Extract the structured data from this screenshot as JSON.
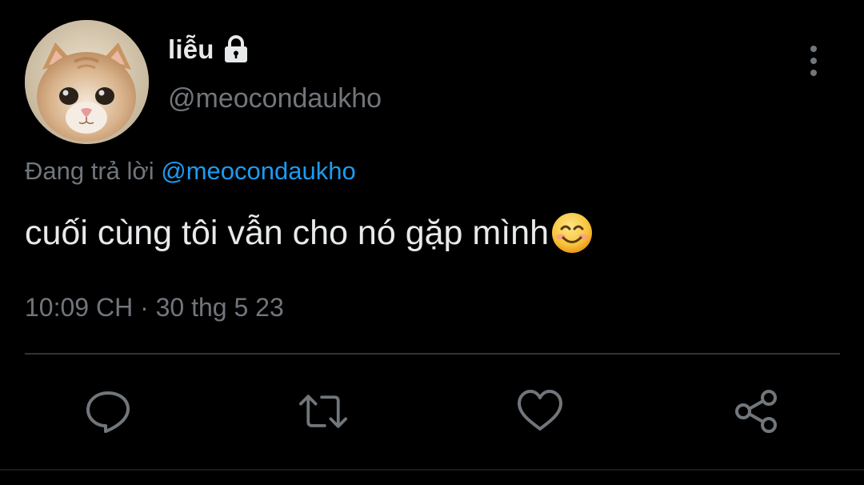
{
  "author": {
    "display_name": "liễu",
    "handle": "@meocondaukho",
    "avatar": "cat-photo",
    "protected_icon": "lock-icon"
  },
  "reply_context": {
    "prefix": "Đang trả lời",
    "mention": "@meocondaukho"
  },
  "tweet": {
    "text": "cuối cùng tôi vẫn cho nó gặp mình",
    "emoji": "smiling-face-emoji",
    "timestamp": "10:09 CH · 30 thg 5 23"
  },
  "actions": [
    "reply-icon",
    "retweet-icon",
    "like-icon",
    "share-icon"
  ],
  "colors": {
    "background": "#000000",
    "primary_text": "#e7e9ea",
    "secondary_text": "#71767b",
    "link": "#1d9bf0",
    "divider": "#2f3336"
  }
}
